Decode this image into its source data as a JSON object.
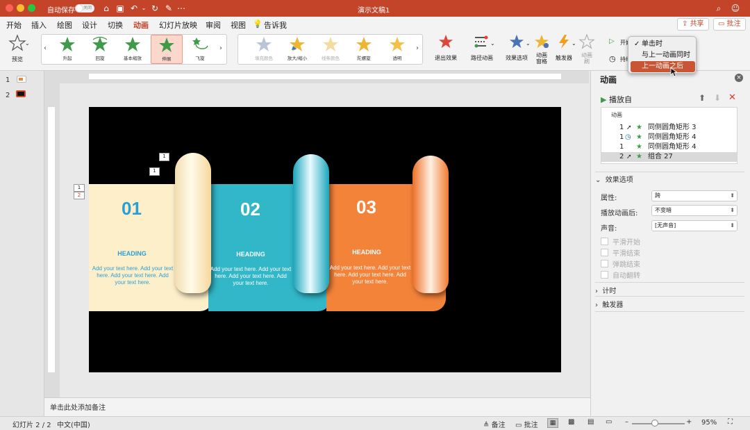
{
  "window": {
    "autosave_label": "自动保存",
    "autosave_state": "关闭",
    "title": "演示文稿1"
  },
  "menu": {
    "items": [
      "开始",
      "插入",
      "绘图",
      "设计",
      "切换",
      "动画",
      "幻灯片放映",
      "审阅",
      "视图"
    ],
    "active": "动画",
    "tell_me": "告诉我",
    "share": "共享",
    "comments": "批注"
  },
  "ribbon": {
    "preview": "预览",
    "entrance_effects": [
      "升起",
      "回旋",
      "基本缩放",
      "伸展",
      "飞旋"
    ],
    "selected_effect": "伸展",
    "emphasis_effects": [
      "填充颜色",
      "放大/缩小",
      "线条颜色",
      "陀螺旋",
      "透明"
    ],
    "exit_effects": "退出效果",
    "motion_paths": "路径动画",
    "effect_options": "效果选项",
    "animation_pane_line1": "动画",
    "animation_pane_line2": "窗格",
    "trigger": "触发器",
    "animation_painter_line1": "动画",
    "animation_painter_line2": "刷",
    "start_label": "开始",
    "timing_label": "持续"
  },
  "start_dropdown": {
    "items": [
      "单击时",
      "与上一动画同时",
      "上一动画之后"
    ],
    "checked": "单击时",
    "highlighted": "上一动画之后"
  },
  "thumbnails": [
    "1",
    "2"
  ],
  "slide": {
    "cards": [
      {
        "number": "01",
        "heading": "HEADING",
        "body": "Add your text here. Add your text here. Add your text here. Add your text here.",
        "color": "#fdefc9",
        "text_color": "#2a9fd6"
      },
      {
        "number": "02",
        "heading": "HEADING",
        "body": "Add your text here. Add your text here. Add your text here. Add your text here.",
        "color": "#31b7c8",
        "text_color": "#ffffff"
      },
      {
        "number": "03",
        "heading": "HEADING",
        "body": "Add your text here. Add your text here. Add your text here. Add your text here.",
        "color": "#f4833a",
        "text_color": "#ffffff"
      }
    ],
    "tags": [
      "1",
      "1",
      "1",
      "2"
    ]
  },
  "notes_placeholder": "单击此处添加备注",
  "status": {
    "slide_counter": "幻灯片 2 / 2",
    "language": "中文(中国)",
    "notes": "备注",
    "comments": "批注",
    "zoom": "95%"
  },
  "pane": {
    "title": "动画",
    "play_from": "播放自",
    "list_header": "动画",
    "animations": [
      {
        "order": "1",
        "trigger": "click",
        "name": "同侧圆角矩形 3"
      },
      {
        "order": "1",
        "trigger": "after",
        "name": "同侧圆角矩形 4"
      },
      {
        "order": "1",
        "trigger": "",
        "name": "同侧圆角矩形 4"
      },
      {
        "order": "2",
        "trigger": "click",
        "name": "组合 27"
      }
    ],
    "effect_options_section": "效果选项",
    "properties_label": "属性:",
    "properties_value": "跨",
    "after_animation_label": "播放动画后:",
    "after_animation_value": "不变暗",
    "sound_label": "声音:",
    "sound_value": "[无声音]",
    "checkboxes": [
      "平滑开始",
      "平滑结束",
      "弹跳结束",
      "自动翻转"
    ],
    "timing_section": "计时",
    "trigger_section": "触发器"
  }
}
